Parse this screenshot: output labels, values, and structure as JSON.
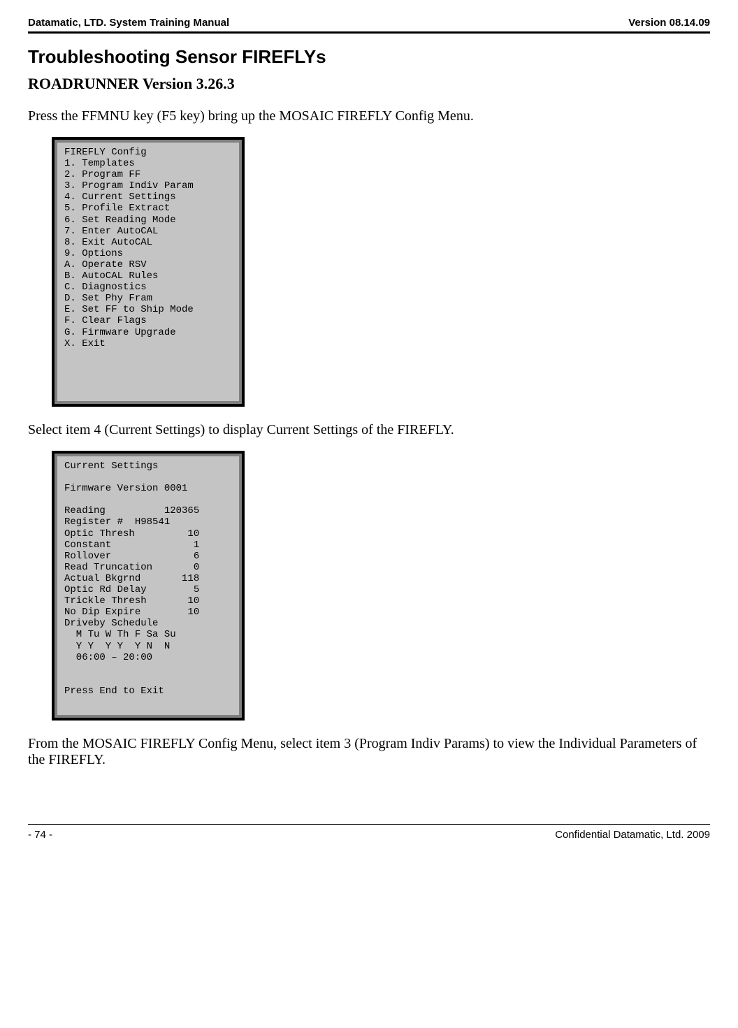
{
  "header": {
    "left": "Datamatic, LTD. System Training  Manual",
    "right": "Version 08.14.09"
  },
  "main_title": "Troubleshooting Sensor FIREFLYs",
  "sub_title": "ROADRUNNER Version 3.26.3",
  "body_text_1": "Press the FFMNU key (F5 key) bring up the MOSAIC FIREFLY Config Menu.",
  "screen1": {
    "content": "FIREFLY Config\n1. Templates\n2. Program FF\n3. Program Indiv Param\n4. Current Settings\n5. Profile Extract\n6. Set Reading Mode\n7. Enter AutoCAL\n8. Exit AutoCAL\n9. Options\nA. Operate RSV\nB. AutoCAL Rules\nC. Diagnostics\nD. Set Phy Fram\nE. Set FF to Ship Mode\nF. Clear Flags\nG. Firmware Upgrade\nX. Exit\n\n\n\n"
  },
  "body_text_2": "Select item 4 (Current Settings) to display Current Settings of the FIREFLY.",
  "screen2": {
    "content": "Current Settings\n\nFirmware Version 0001\n\nReading          120365\nRegister #  H98541\nOptic Thresh         10\nConstant              1\nRollover              6\nRead Truncation       0\nActual Bkgrnd       118\nOptic Rd Delay        5\nTrickle Thresh       10\nNo Dip Expire        10\nDriveby Schedule\n  M Tu W Th F Sa Su\n  Y Y  Y Y  Y N  N\n  06:00 – 20:00\n\n\nPress End to Exit\n\n"
  },
  "body_text_3": "From the MOSAIC FIREFLY Config Menu, select item 3 (Program Indiv Params) to view the Individual Parameters of the FIREFLY.",
  "footer": {
    "left": "- 74 -",
    "right": "Confidential Datamatic, Ltd. 2009"
  }
}
